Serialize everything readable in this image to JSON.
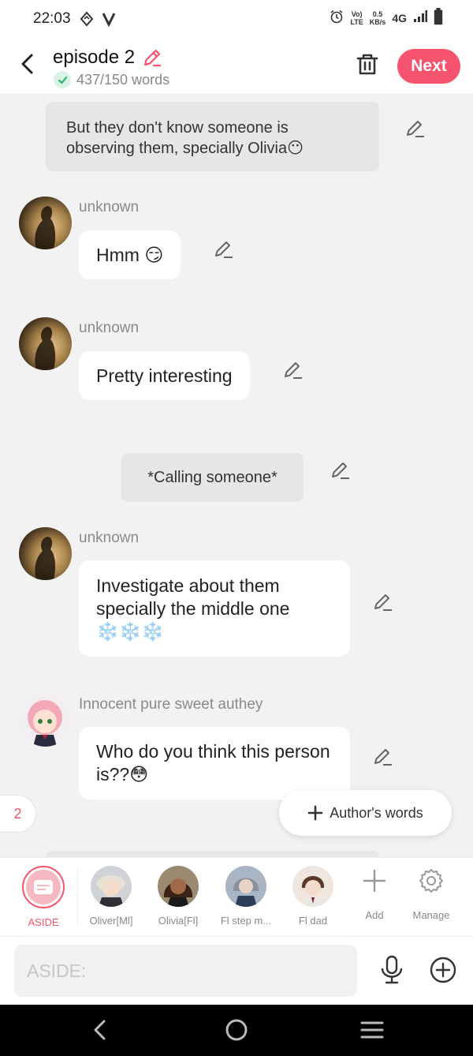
{
  "status_bar": {
    "time": "22:03",
    "speed_value": "0.5",
    "speed_unit": "KB/s",
    "volte_top": "Vo)",
    "volte_bottom": "LTE",
    "network": "4G"
  },
  "header": {
    "episode_title": "episode 2",
    "word_count": "437/150 words",
    "next_label": "Next"
  },
  "messages": [
    {
      "type": "narration",
      "text": "But they don't know someone is observing them, specially Olivia😶"
    },
    {
      "type": "dialogue",
      "speaker": "unknown",
      "text": "Hmm 😏"
    },
    {
      "type": "dialogue",
      "speaker": "unknown",
      "text": "Pretty interesting"
    },
    {
      "type": "narration",
      "text": "*Calling someone*"
    },
    {
      "type": "dialogue",
      "speaker": "unknown",
      "text": "Investigate about them specially the middle one ❄️❄️❄️"
    },
    {
      "type": "dialogue",
      "speaker": "Innocent pure sweet authey",
      "text": "Who do you think this person is??😳"
    }
  ],
  "unread_count": "2",
  "author_words_label": "Author's words",
  "characters": [
    {
      "label": "ASIDE"
    },
    {
      "label": "Oliver[Ml]"
    },
    {
      "label": "Olivia[Fl]"
    },
    {
      "label": "Fl step m..."
    },
    {
      "label": "Fl dad"
    }
  ],
  "tools": {
    "add_label": "Add",
    "manage_label": "Manage"
  },
  "input": {
    "placeholder": "ASIDE:",
    "value": ""
  },
  "colors": {
    "accent": "#f5536e",
    "background": "#f2f2f2"
  }
}
